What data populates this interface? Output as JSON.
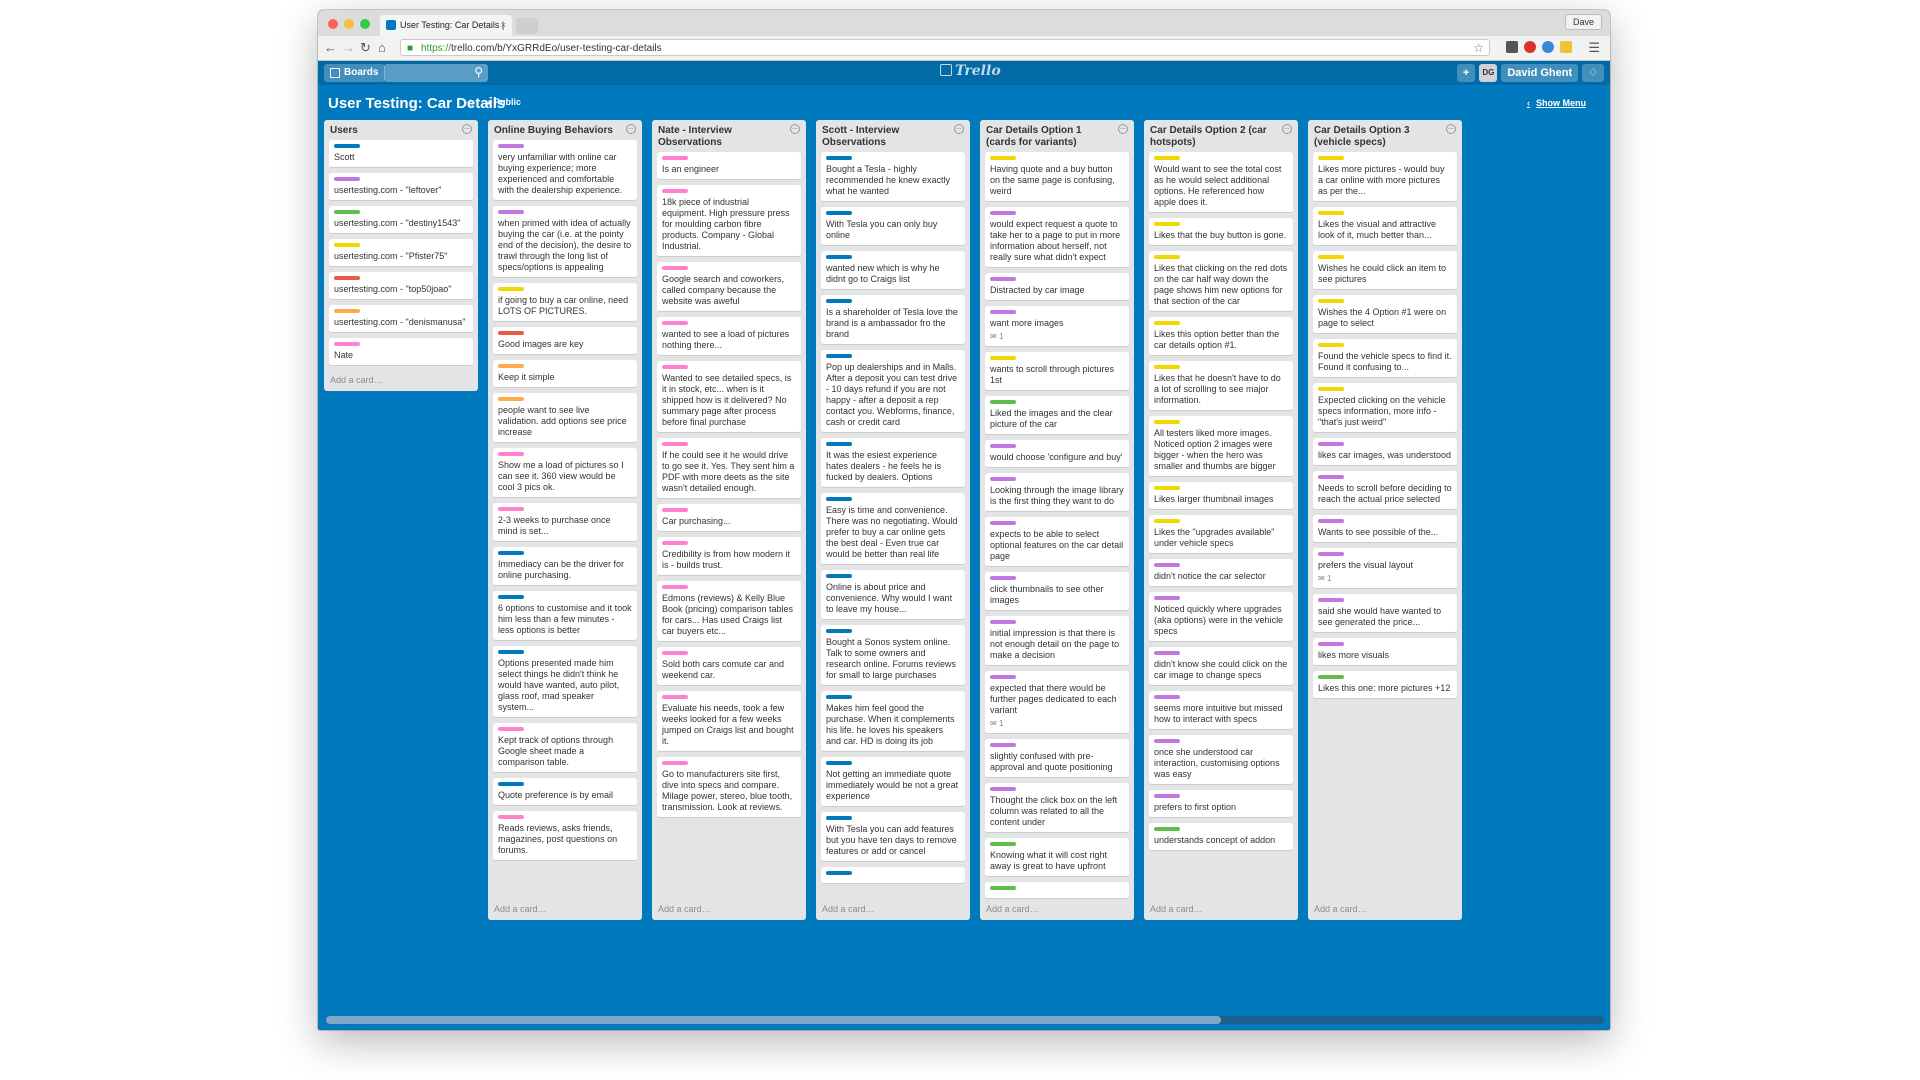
{
  "browser": {
    "tab_title": "User Testing: Car Details |",
    "tab_close": "×",
    "user_chip": "Dave",
    "url_scheme": "https://",
    "url_rest": "trello.com/b/YxGRRdEo/user-testing-car-details"
  },
  "header": {
    "boards_label": "Boards",
    "logo": "Trello",
    "add_label": "+",
    "avatar_initials": "DG",
    "user_name": "David Ghent"
  },
  "board": {
    "title": "User Testing: Car Details",
    "visibility": "Public",
    "show_menu": "Show Menu",
    "add_card_label": "Add a card…"
  },
  "colors": {
    "blue": "#0079bf",
    "purple": "#c377e0",
    "green": "#61bd4f",
    "yellow": "#f2d600",
    "red": "#eb5a46",
    "orange": "#ffab4a",
    "pink": "#ff80ce"
  },
  "lists": [
    {
      "title": "Users",
      "cards": [
        {
          "label": "blue",
          "text": "Scott"
        },
        {
          "label": "purple",
          "text": "usertesting.com - \"leftover\""
        },
        {
          "label": "green",
          "text": "usertesting.com - \"destiny1543\""
        },
        {
          "label": "yellow",
          "text": "usertesting.com - \"Pfister75\""
        },
        {
          "label": "red",
          "text": "usertesting.com - \"top50joao\""
        },
        {
          "label": "orange",
          "text": "usertesting.com - \"denismanusa\""
        },
        {
          "label": "pink",
          "text": "Nate"
        }
      ]
    },
    {
      "title": "Online Buying Behaviors",
      "cards": [
        {
          "label": "purple",
          "text": "very unfamiliar with online car buying experience; more experienced and comfortable with the dealership experience."
        },
        {
          "label": "purple",
          "text": "when primed with idea of actually buying the car (i.e. at the pointy end of the decision), the desire to trawl through the long list of specs/options is appealing"
        },
        {
          "label": "yellow",
          "text": "if going to buy a car online, need LOTS OF PICTURES."
        },
        {
          "label": "red",
          "text": "Good images are key"
        },
        {
          "label": "orange",
          "text": "Keep it simple"
        },
        {
          "label": "orange",
          "text": "people want to see live validation. add options see price increase"
        },
        {
          "label": "pink",
          "text": "Show me a load of pictures so I can see it. 360 view would be cool 3 pics ok."
        },
        {
          "label": "pink",
          "text": "2-3 weeks to purchase once mind is set..."
        },
        {
          "label": "blue",
          "text": "Immediacy can be the driver for online purchasing."
        },
        {
          "label": "blue",
          "text": "6 options to customise and it took him less than a few minutes - less options is better"
        },
        {
          "label": "blue",
          "text": "Options presented made him select things he didn't think he would have wanted, auto pilot, glass roof, mad speaker system..."
        },
        {
          "label": "pink",
          "text": "Kept track of options through Google sheet made a comparison table."
        },
        {
          "label": "blue",
          "text": "Quote preference is by email"
        },
        {
          "label": "pink",
          "text": "Reads reviews, asks friends, magazines, post questions on forums."
        }
      ]
    },
    {
      "title": "Nate - Interview Observations",
      "cards": [
        {
          "label": "pink",
          "text": "Is an engineer"
        },
        {
          "label": "pink",
          "text": "18k piece of industrial equipment. High pressure press for moulding carbon fibre products. Company - Global Industrial."
        },
        {
          "label": "pink",
          "text": "Google search and coworkers, called company because the website was aweful"
        },
        {
          "label": "pink",
          "text": "wanted to see a load of pictures nothing there..."
        },
        {
          "label": "pink",
          "text": "Wanted to see detailed specs, is it in stock, etc... when is it shipped how is it delivered? No summary page after process before final purchase"
        },
        {
          "label": "pink",
          "text": "If he could see it he would drive to go see it. Yes. They sent him a PDF with more deets as the site wasn't detailed enough."
        },
        {
          "label": "pink",
          "text": "Car purchasing..."
        },
        {
          "label": "pink",
          "text": "Credibility is from how modern it is - builds trust."
        },
        {
          "label": "pink",
          "text": "Edmons (reviews) & Kelly Blue Book (pricing) comparison tables for cars... Has used Craigs list car buyers etc..."
        },
        {
          "label": "pink",
          "text": "Sold both cars comute car and weekend car."
        },
        {
          "label": "pink",
          "text": "Evaluate his needs, took a few weeks looked for a few weeks jumped on Craigs list and bought it."
        },
        {
          "label": "pink",
          "text": "Go to manufacturers site first, dive into specs and compare. Milage power, stereo, blue tooth, transmission. Look at reviews."
        }
      ]
    },
    {
      "title": "Scott - Interview Observations",
      "cards": [
        {
          "label": "blue",
          "text": "Bought a Tesla - highly recommended he knew exactly what he wanted"
        },
        {
          "label": "blue",
          "text": "With Tesla you can only buy online"
        },
        {
          "label": "blue",
          "text": "wanted new which is why he didnt go to Craigs list"
        },
        {
          "label": "blue",
          "text": "Is a shareholder of Tesla love the brand is a ambassador fro the brand"
        },
        {
          "label": "blue",
          "text": "Pop up dealerships and in Malls. After a deposit you can test drive - 10 days refund if you are not happy - after a deposit a rep contact you. Webforms, finance, cash or credit card"
        },
        {
          "label": "blue",
          "text": "It was the esiest experience hates dealers - he feels he is fucked by dealers. Options"
        },
        {
          "label": "blue",
          "text": "Easy is time and convenience. There was no negotiating. Would prefer to buy a car online gets the best deal - Even true car would be better than real life"
        },
        {
          "label": "blue",
          "text": "Online is about price and convenience. Why would I want to leave my house..."
        },
        {
          "label": "blue",
          "text": "Bought a Sonos system online. Talk to some owners and research online. Forums reviews for small to large purchases"
        },
        {
          "label": "blue",
          "text": "Makes him feel good the purchase. When it complements his life. he loves his speakers and car. HD is doing its job"
        },
        {
          "label": "blue",
          "text": "Not getting an immediate quote immediately would be not a great experience"
        },
        {
          "label": "blue",
          "text": "With Tesla you can add features but you have ten days to remove features or add or cancel"
        },
        {
          "label": "blue",
          "text": ""
        }
      ]
    },
    {
      "title": "Car Details Option 1 (cards for variants)",
      "cards": [
        {
          "label": "yellow",
          "text": "Having quote and a buy button on the same page is confusing, weird"
        },
        {
          "label": "purple",
          "text": "would expect request a quote to take her to a page to put in more information about herself, not really sure what didn't expect"
        },
        {
          "label": "purple",
          "text": "Distracted by car image"
        },
        {
          "label": "purple",
          "text": "want more images",
          "badge": "1"
        },
        {
          "label": "yellow",
          "text": "wants to scroll through pictures 1st"
        },
        {
          "label": "green",
          "text": "Liked the images and the clear picture of the car"
        },
        {
          "label": "purple",
          "text": "would choose 'configure and buy'"
        },
        {
          "label": "purple",
          "text": "Looking through the image library is the first thing they want to do"
        },
        {
          "label": "purple",
          "text": "expects to be able to select optional features on the car detail page"
        },
        {
          "label": "purple",
          "text": "click thumbnails to see other images"
        },
        {
          "label": "purple",
          "text": "initial impression is that there is not enough detail on the page to make a decision"
        },
        {
          "label": "purple",
          "text": "expected that there would be further pages dedicated to each variant",
          "badge": "1"
        },
        {
          "label": "purple",
          "text": "slightly confused with pre-approval and quote positioning"
        },
        {
          "label": "purple",
          "text": "Thought the click box on the left column was related to all the content under"
        },
        {
          "label": "green",
          "text": "Knowing what it will cost right away is great to have upfront"
        },
        {
          "label": "green",
          "text": ""
        }
      ]
    },
    {
      "title": "Car Details Option 2 (car hotspots)",
      "cards": [
        {
          "label": "yellow",
          "text": "Would want to see the total cost as he would select additional options. He referenced how apple does it."
        },
        {
          "label": "yellow",
          "text": "Likes that the buy button is gone."
        },
        {
          "label": "yellow",
          "text": "Likes that clicking on the red dots on the car half way down the page shows him new options for that section of the car"
        },
        {
          "label": "yellow",
          "text": "Likes this option better than the car details option #1."
        },
        {
          "label": "yellow",
          "text": "Likes that he doesn't have to do a lot of scrolling to see major information."
        },
        {
          "label": "yellow",
          "text": "All testers liked more images. Noticed option 2 images were bigger - when the hero was smaller and thumbs are bigger"
        },
        {
          "label": "yellow",
          "text": "Likes larger thumbnail images"
        },
        {
          "label": "yellow",
          "text": "Likes the \"upgrades available\" under vehicle specs"
        },
        {
          "label": "purple",
          "text": "didn't notice the car selector"
        },
        {
          "label": "purple",
          "text": "Noticed quickly where upgrades (aka options) were in the vehicle specs"
        },
        {
          "label": "purple",
          "text": "didn't know she could click on the car image to change specs"
        },
        {
          "label": "purple",
          "text": "seems more intuitive but missed how to interact with specs"
        },
        {
          "label": "purple",
          "text": "once she understood car interaction, customising options was easy"
        },
        {
          "label": "purple",
          "text": "prefers to first option"
        },
        {
          "label": "green",
          "text": "understands concept of addon"
        }
      ]
    },
    {
      "title": "Car Details Option 3 (vehicle specs)",
      "cards": [
        {
          "label": "yellow",
          "text": "Likes more pictures - would buy a car online with more pictures as per the..."
        },
        {
          "label": "yellow",
          "text": "Likes the visual and attractive look of it, much better than..."
        },
        {
          "label": "yellow",
          "text": "Wishes he could click an item to see pictures"
        },
        {
          "label": "yellow",
          "text": "Wishes the 4 Option #1 were on page to select"
        },
        {
          "label": "yellow",
          "text": "Found the vehicle specs to find it. Found it confusing to..."
        },
        {
          "label": "yellow",
          "text": "Expected clicking on the vehicle specs information, more info - \"that's just weird\""
        },
        {
          "label": "purple",
          "text": "likes car images, was understood"
        },
        {
          "label": "purple",
          "text": "Needs to scroll before deciding to reach the actual price selected"
        },
        {
          "label": "purple",
          "text": "Wants to see possible of the..."
        },
        {
          "label": "purple",
          "text": "prefers the visual layout",
          "badge": "1"
        },
        {
          "label": "purple",
          "text": "said she would have wanted to see generated the price..."
        },
        {
          "label": "purple",
          "text": "likes more visuals"
        },
        {
          "label": "green",
          "text": "Likes this one: more pictures +12"
        }
      ]
    }
  ]
}
